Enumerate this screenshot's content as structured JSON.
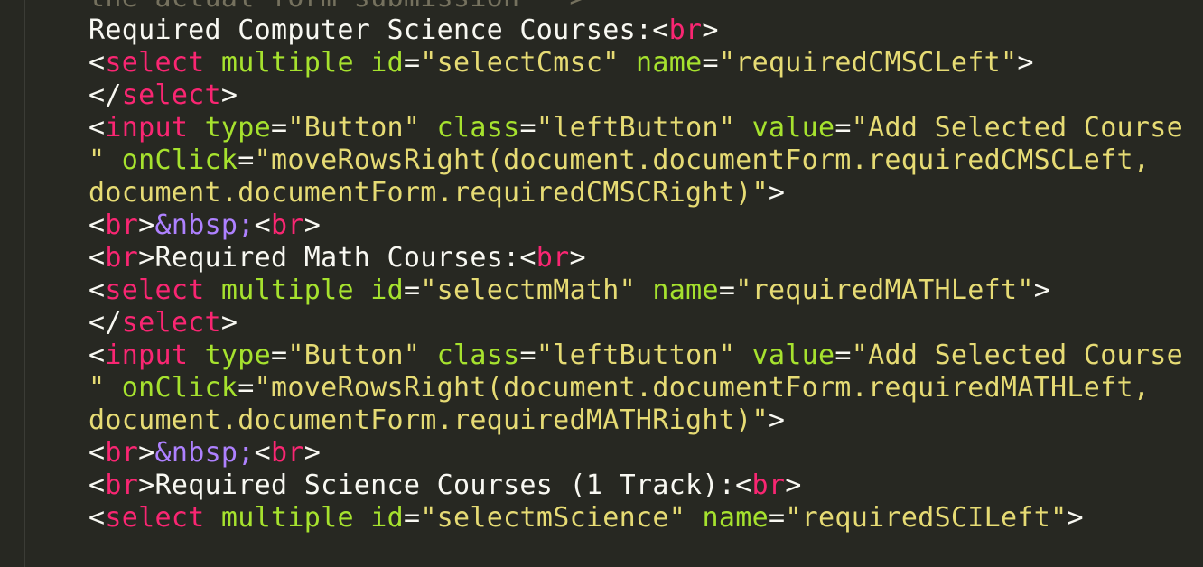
{
  "editor": {
    "theme": {
      "background": "#272822",
      "text": "#f8f8f2",
      "tag": "#f92672",
      "attribute": "#a6e22e",
      "string": "#e6db74",
      "entity": "#ae81ff",
      "comment": "#75715e"
    },
    "lines": [
      [
        {
          "t": "cmt",
          "v": "the actual form submission -->"
        }
      ],
      [
        {
          "t": "text",
          "v": "Required Computer Science Courses:<"
        },
        {
          "t": "tag",
          "v": "br"
        },
        {
          "t": "text",
          "v": ">"
        }
      ],
      [
        {
          "t": "text",
          "v": "<"
        },
        {
          "t": "tag",
          "v": "select"
        },
        {
          "t": "text",
          "v": " "
        },
        {
          "t": "attr",
          "v": "multiple"
        },
        {
          "t": "text",
          "v": " "
        },
        {
          "t": "attr",
          "v": "id"
        },
        {
          "t": "text",
          "v": "="
        },
        {
          "t": "str",
          "v": "\"selectCmsc\""
        },
        {
          "t": "text",
          "v": " "
        },
        {
          "t": "attr",
          "v": "name"
        },
        {
          "t": "text",
          "v": "="
        },
        {
          "t": "str",
          "v": "\"requiredCMSCLeft\""
        },
        {
          "t": "text",
          "v": ">"
        }
      ],
      [
        {
          "t": "text",
          "v": "</"
        },
        {
          "t": "tag",
          "v": "select"
        },
        {
          "t": "text",
          "v": ">"
        }
      ],
      [
        {
          "t": "text",
          "v": "<"
        },
        {
          "t": "tag",
          "v": "input"
        },
        {
          "t": "text",
          "v": " "
        },
        {
          "t": "attr",
          "v": "type"
        },
        {
          "t": "text",
          "v": "="
        },
        {
          "t": "str",
          "v": "\"Button\""
        },
        {
          "t": "text",
          "v": " "
        },
        {
          "t": "attr",
          "v": "class"
        },
        {
          "t": "text",
          "v": "="
        },
        {
          "t": "str",
          "v": "\"leftButton\""
        },
        {
          "t": "text",
          "v": " "
        },
        {
          "t": "attr",
          "v": "value"
        },
        {
          "t": "text",
          "v": "="
        },
        {
          "t": "str",
          "v": "\"Add Selected Course ->"
        }
      ],
      [
        {
          "t": "str",
          "v": "\""
        },
        {
          "t": "text",
          "v": " "
        },
        {
          "t": "attr",
          "v": "onClick"
        },
        {
          "t": "text",
          "v": "="
        },
        {
          "t": "str",
          "v": "\"moveRowsRight(document.documentForm.requiredCMSCLeft,"
        }
      ],
      [
        {
          "t": "str",
          "v": "document.documentForm.requiredCMSCRight)\""
        },
        {
          "t": "text",
          "v": ">"
        }
      ],
      [
        {
          "t": "text",
          "v": "<"
        },
        {
          "t": "tag",
          "v": "br"
        },
        {
          "t": "text",
          "v": ">"
        },
        {
          "t": "ent",
          "v": "&nbsp;"
        },
        {
          "t": "text",
          "v": "<"
        },
        {
          "t": "tag",
          "v": "br"
        },
        {
          "t": "text",
          "v": ">"
        }
      ],
      [
        {
          "t": "text",
          "v": "<"
        },
        {
          "t": "tag",
          "v": "br"
        },
        {
          "t": "text",
          "v": ">Required Math Courses:<"
        },
        {
          "t": "tag",
          "v": "br"
        },
        {
          "t": "text",
          "v": ">"
        }
      ],
      [
        {
          "t": "text",
          "v": "<"
        },
        {
          "t": "tag",
          "v": "select"
        },
        {
          "t": "text",
          "v": " "
        },
        {
          "t": "attr",
          "v": "multiple"
        },
        {
          "t": "text",
          "v": " "
        },
        {
          "t": "attr",
          "v": "id"
        },
        {
          "t": "text",
          "v": "="
        },
        {
          "t": "str",
          "v": "\"selectmMath\""
        },
        {
          "t": "text",
          "v": " "
        },
        {
          "t": "attr",
          "v": "name"
        },
        {
          "t": "text",
          "v": "="
        },
        {
          "t": "str",
          "v": "\"requiredMATHLeft\""
        },
        {
          "t": "text",
          "v": ">"
        }
      ],
      [
        {
          "t": "text",
          "v": "</"
        },
        {
          "t": "tag",
          "v": "select"
        },
        {
          "t": "text",
          "v": ">"
        }
      ],
      [
        {
          "t": "text",
          "v": "<"
        },
        {
          "t": "tag",
          "v": "input"
        },
        {
          "t": "text",
          "v": " "
        },
        {
          "t": "attr",
          "v": "type"
        },
        {
          "t": "text",
          "v": "="
        },
        {
          "t": "str",
          "v": "\"Button\""
        },
        {
          "t": "text",
          "v": " "
        },
        {
          "t": "attr",
          "v": "class"
        },
        {
          "t": "text",
          "v": "="
        },
        {
          "t": "str",
          "v": "\"leftButton\""
        },
        {
          "t": "text",
          "v": " "
        },
        {
          "t": "attr",
          "v": "value"
        },
        {
          "t": "text",
          "v": "="
        },
        {
          "t": "str",
          "v": "\"Add Selected Course ->"
        }
      ],
      [
        {
          "t": "str",
          "v": "\""
        },
        {
          "t": "text",
          "v": " "
        },
        {
          "t": "attr",
          "v": "onClick"
        },
        {
          "t": "text",
          "v": "="
        },
        {
          "t": "str",
          "v": "\"moveRowsRight(document.documentForm.requiredMATHLeft,"
        }
      ],
      [
        {
          "t": "str",
          "v": "document.documentForm.requiredMATHRight)\""
        },
        {
          "t": "text",
          "v": ">"
        }
      ],
      [
        {
          "t": "text",
          "v": "<"
        },
        {
          "t": "tag",
          "v": "br"
        },
        {
          "t": "text",
          "v": ">"
        },
        {
          "t": "ent",
          "v": "&nbsp;"
        },
        {
          "t": "text",
          "v": "<"
        },
        {
          "t": "tag",
          "v": "br"
        },
        {
          "t": "text",
          "v": ">"
        }
      ],
      [
        {
          "t": "text",
          "v": "<"
        },
        {
          "t": "tag",
          "v": "br"
        },
        {
          "t": "text",
          "v": ">Required Science Courses (1 Track):<"
        },
        {
          "t": "tag",
          "v": "br"
        },
        {
          "t": "text",
          "v": ">"
        }
      ],
      [
        {
          "t": "text",
          "v": "<"
        },
        {
          "t": "tag",
          "v": "select"
        },
        {
          "t": "text",
          "v": " "
        },
        {
          "t": "attr",
          "v": "multiple"
        },
        {
          "t": "text",
          "v": " "
        },
        {
          "t": "attr",
          "v": "id"
        },
        {
          "t": "text",
          "v": "="
        },
        {
          "t": "str",
          "v": "\"selectmScience\""
        },
        {
          "t": "text",
          "v": " "
        },
        {
          "t": "attr",
          "v": "name"
        },
        {
          "t": "text",
          "v": "="
        },
        {
          "t": "str",
          "v": "\"requiredSCILeft\""
        },
        {
          "t": "text",
          "v": ">"
        }
      ]
    ]
  }
}
